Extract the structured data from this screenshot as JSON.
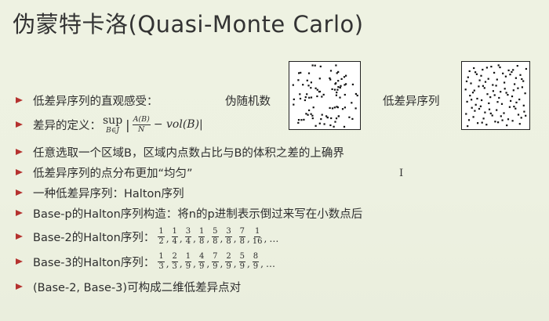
{
  "slide": {
    "title": "伪蒙特卡洛(Quasi-Monte Carlo)",
    "bullets": [
      {
        "text": "低差异序列的直观感受："
      },
      {
        "prefix": "差异的定义：",
        "formula": {
          "op": "sup",
          "sub": "B∈J",
          "num": "A(B)",
          "den": "N",
          "tail": "− vol(B)|"
        }
      },
      {
        "text": "任意选取一个区域B，区域内点数占比与B的体积之差的上确界"
      },
      {
        "text": "低差异序列的点分布更加“均匀”"
      },
      {
        "text": "一种低差异序列：Halton序列"
      },
      {
        "text": "Base-p的Halton序列构造：将n的p进制表示倒过来写在小数点后"
      },
      {
        "prefix": "Base-2的Halton序列：",
        "seq": [
          [
            "1",
            "2"
          ],
          [
            "1",
            "4"
          ],
          [
            "3",
            "4"
          ],
          [
            "1",
            "8"
          ],
          [
            "5",
            "8"
          ],
          [
            "3",
            "8"
          ],
          [
            "7",
            "8"
          ],
          [
            "1",
            "16"
          ]
        ],
        "ellipsis": "…"
      },
      {
        "prefix": "Base-3的Halton序列：",
        "seq": [
          [
            "1",
            "3"
          ],
          [
            "2",
            "3"
          ],
          [
            "1",
            "9"
          ],
          [
            "4",
            "9"
          ],
          [
            "7",
            "9"
          ],
          [
            "2",
            "9"
          ],
          [
            "5",
            "9"
          ],
          [
            "8",
            "9"
          ]
        ],
        "ellipsis": "…"
      },
      {
        "text": "(Base-2, Base-3)可构成二维低差异点对"
      }
    ],
    "labels": {
      "pseudo_random": "伪随机数",
      "low_discrepancy": "低差异序列"
    },
    "cursor_glyph": "I",
    "colors": {
      "background": "#eef2e2",
      "bullet_arrow": "#b5322f",
      "text": "#2e2e2e"
    },
    "icons": {
      "bullet": "triangle-bullet-icon"
    }
  }
}
